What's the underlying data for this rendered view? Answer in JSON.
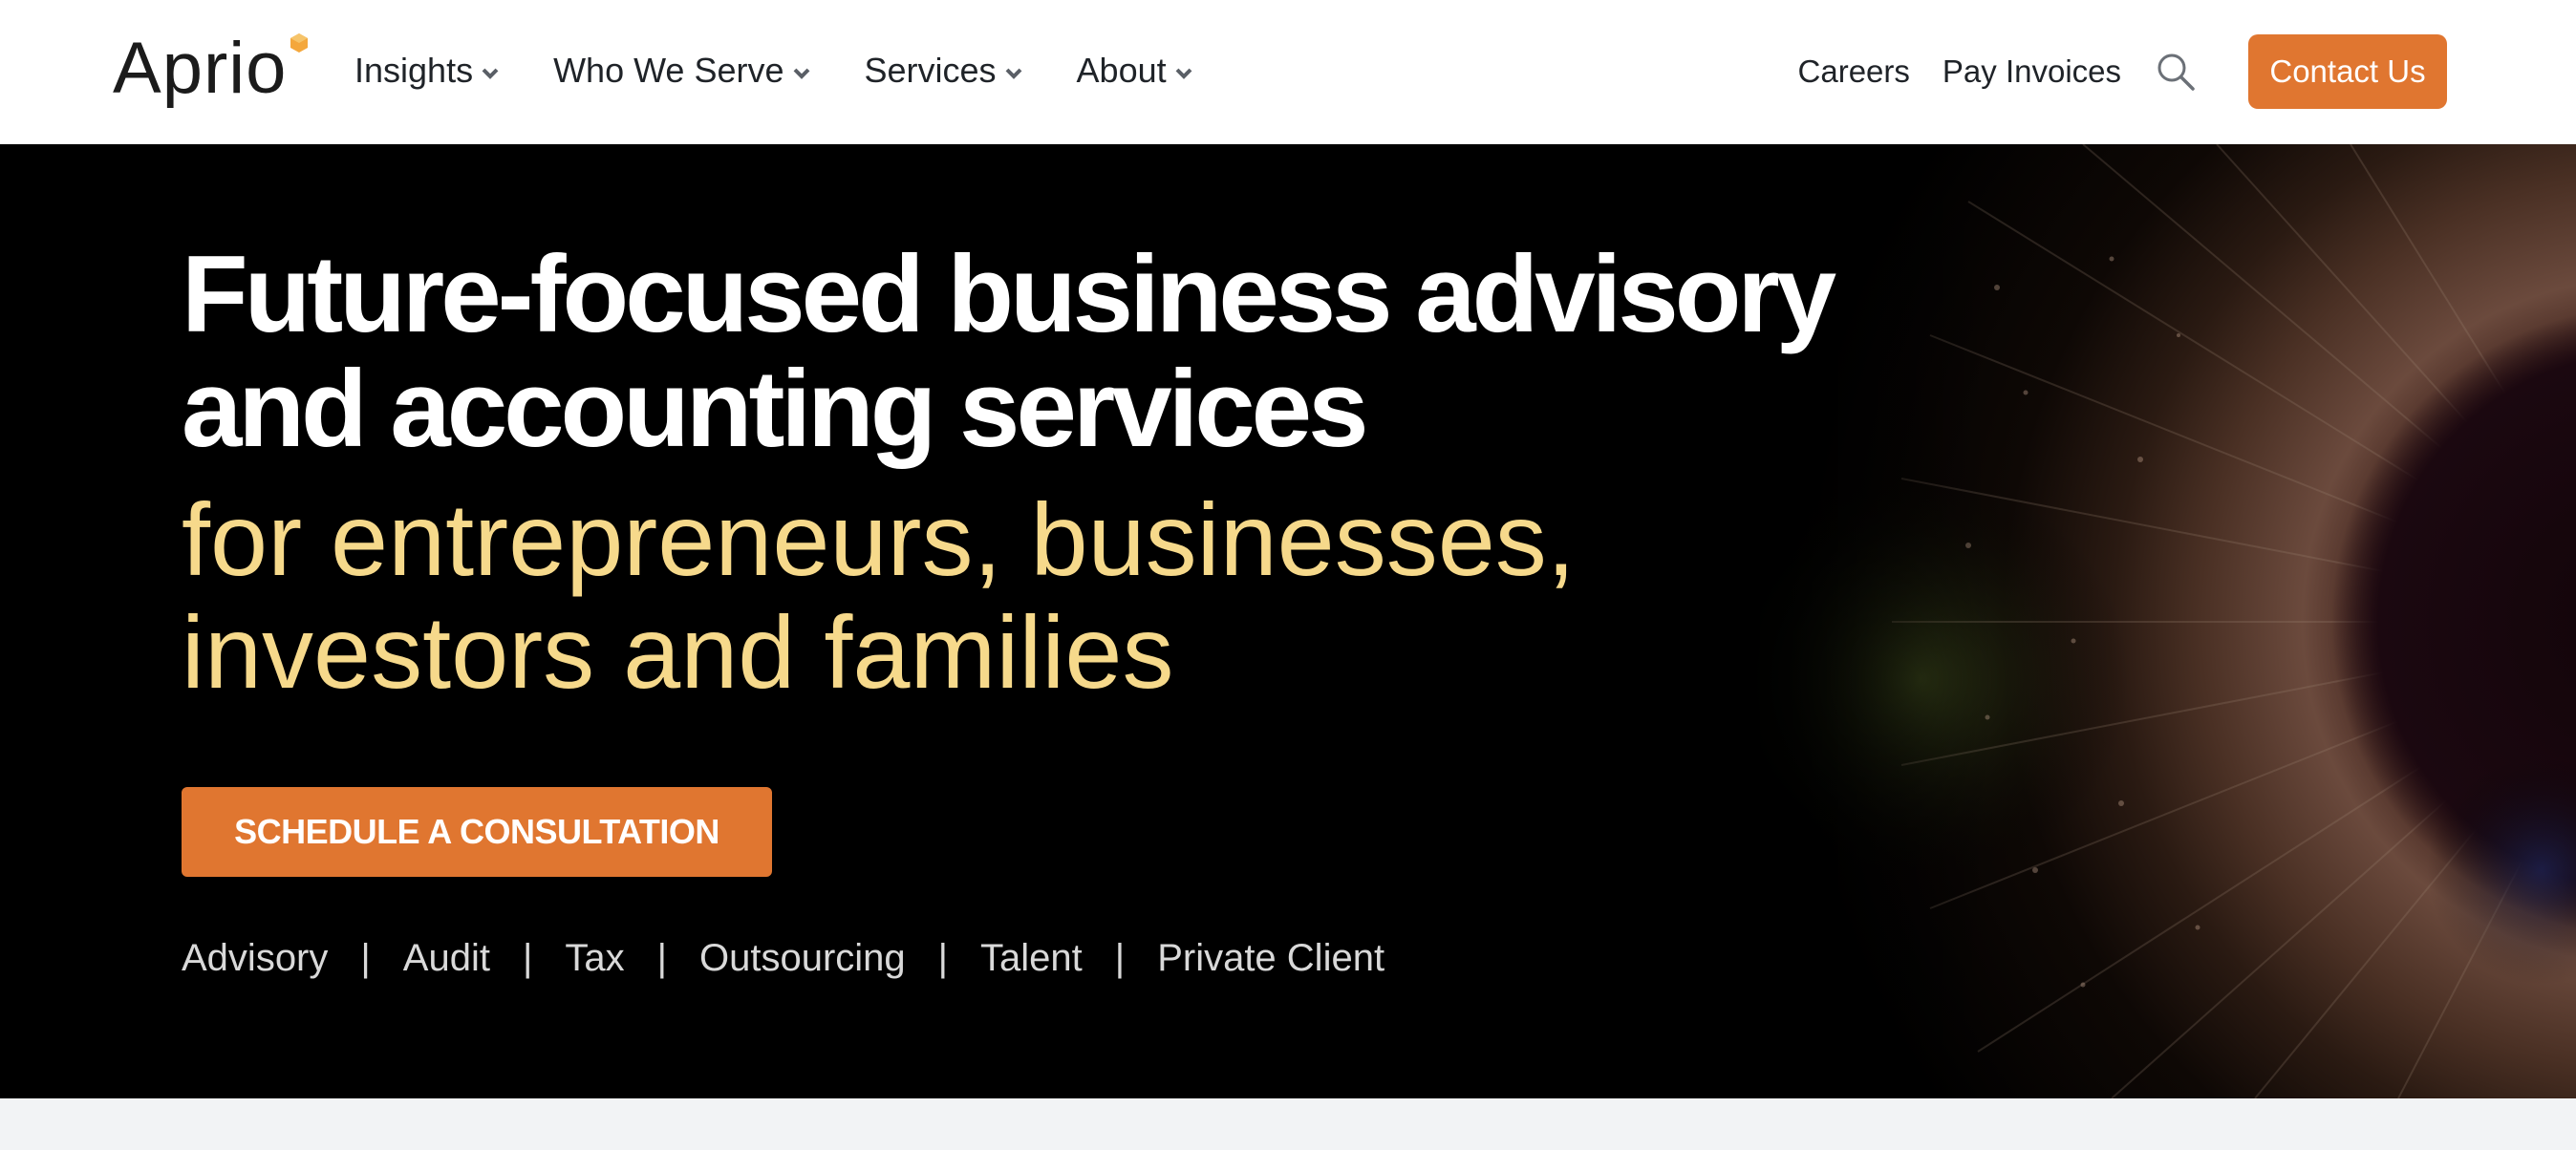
{
  "header": {
    "logo_text": "Aprio",
    "nav": [
      {
        "label": "Insights"
      },
      {
        "label": "Who We Serve"
      },
      {
        "label": "Services"
      },
      {
        "label": "About"
      }
    ],
    "careers_label": "Careers",
    "pay_invoices_label": "Pay Invoices",
    "search_icon": "search-icon",
    "contact_label": "Contact Us"
  },
  "hero": {
    "title": "Future-focused business advisory and accounting services",
    "subtitle": "for entrepreneurs, businesses, investors and families",
    "cta_label": "SCHEDULE A CONSULTATION",
    "services": [
      {
        "label": "Advisory"
      },
      {
        "label": "Audit"
      },
      {
        "label": "Tax"
      },
      {
        "label": "Outsourcing"
      },
      {
        "label": "Talent"
      },
      {
        "label": "Private Client"
      }
    ],
    "separator": "|"
  },
  "colors": {
    "accent": "#e07630",
    "hero_background": "#000000",
    "subtitle": "#f6d98b",
    "page_background": "#f2f3f5"
  }
}
